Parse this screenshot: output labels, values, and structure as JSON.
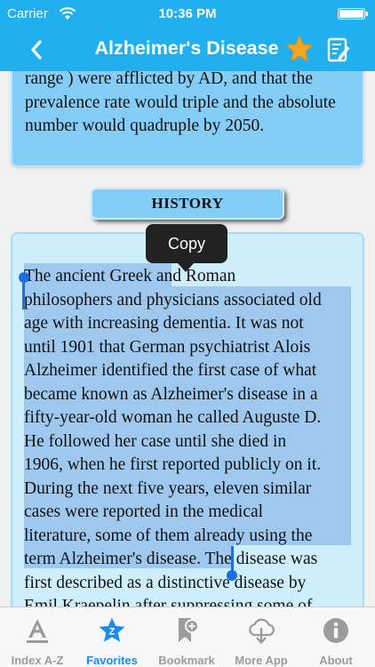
{
  "status_bar": {
    "carrier": "Carrier",
    "time": "10:36 PM"
  },
  "nav": {
    "title": "Alzheimer's Disease"
  },
  "top_card": {
    "text": "range ) were afflicted by AD, and that the prevalence rate would triple and the absolute number would quadruple by 2050."
  },
  "section": {
    "heading": "HISTORY"
  },
  "article": {
    "text": "The ancient Greek and Roman\nphilosophers and physicians associated old\nage with increasing dementia. It was not\nuntil 1901 that German psychiatrist Alois\nAlzheimer identified the first case of what\nbecame known as Alzheimer's disease in a\nfifty-year-old woman he called Auguste D.\nHe followed her case until she died in\n1906, when he first reported publicly on it.\nDuring the next five years, eleven similar\ncases were reported in the medical\nliterature, some of them already using the\nterm Alzheimer's disease. The disease was\nfirst described as a distinctive disease by\nEmil Kraepelin after suppressing some of"
  },
  "context_menu": {
    "copy_label": "Copy"
  },
  "tabs": [
    {
      "label": "Index A-Z",
      "icon": "index-a-icon",
      "active": false
    },
    {
      "label": "Favorites",
      "icon": "favorites-star-icon",
      "active": true
    },
    {
      "label": "Bookmark",
      "icon": "bookmark-icon",
      "active": false
    },
    {
      "label": "More App",
      "icon": "cloud-download-icon",
      "active": false
    },
    {
      "label": "About",
      "icon": "info-icon",
      "active": false
    }
  ],
  "colors": {
    "header": "#20b0f0",
    "card_dark": "#84cdf7",
    "card_light": "#cfeefc",
    "selection": "#78aae1",
    "accent_tab": "#1a8cf0",
    "star": "#f5a623"
  }
}
